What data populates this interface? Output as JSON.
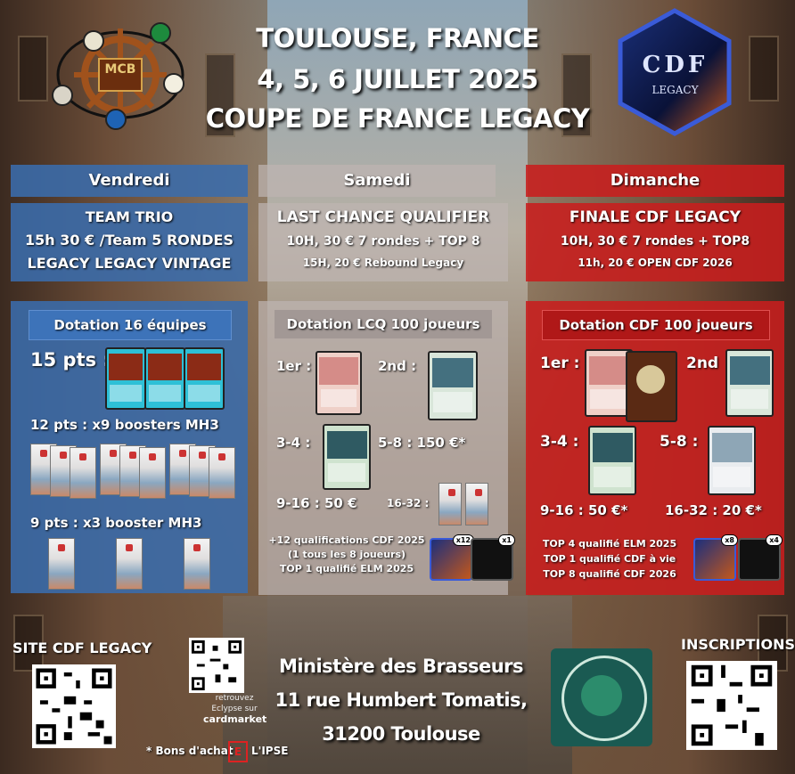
{
  "header": {
    "line1": "TOULOUSE, FRANCE",
    "line2": "4, 5, 6 JUILLET 2025",
    "line3": "COUPE DE FRANCE LEGACY"
  },
  "logos": {
    "mcb": "MCB",
    "cdf_main": "CDF",
    "cdf_sub": "LEGACY"
  },
  "days": {
    "friday": {
      "label": "Vendredi",
      "line1": "TEAM TRIO",
      "line2": "15h 30 € /Team 5 RONDES",
      "line3": "LEGACY LEGACY VINTAGE",
      "dotation": "Dotation 16 équipes",
      "tier1": "15 pts :",
      "tier2": "12 pts : x9 boosters MH3",
      "tier3": "9 pts : x3 booster MH3"
    },
    "saturday": {
      "label": "Samedi",
      "line1": "LAST CHANCE QUALIFIER",
      "line2": "10H, 30 € 7 rondes + TOP 8",
      "line3": "15H, 20 € Rebound Legacy",
      "dotation": "Dotation LCQ 100 joueurs",
      "p1": "1er :",
      "p2": "2nd :",
      "p34": "3-4 :",
      "p58": "5-8 : 150 €*",
      "p916": "9-16 : 50 €",
      "p1632": "16-32 :",
      "info1": "+12 qualifications CDF 2025",
      "info2": "(1 tous les 8 joueurs)",
      "info3": "TOP 1 qualifié ELM 2025",
      "badge1": "x12",
      "badge2": "x1"
    },
    "sunday": {
      "label": "Dimanche",
      "line1": "FINALE CDF LEGACY",
      "line2": "10H, 30 € 7 rondes + TOP8",
      "line3": "11h, 20 € OPEN CDF 2026",
      "dotation": "Dotation CDF 100 joueurs",
      "p1": "1er :",
      "p2": "2nd",
      "p34": "3-4 :",
      "p58": "5-8 :",
      "p916": "9-16 : 50 €*",
      "p1632": "16-32 : 20 €*",
      "info1": "TOP 4 qualifié ELM 2025",
      "info2": "TOP 1 qualifié CDF à vie",
      "info3": "TOP 8 qualifié CDF 2026",
      "badge1": "x8",
      "badge2": "x4"
    }
  },
  "footer": {
    "site": "SITE CDF LEGACY",
    "cardmarket1": "retrouvez",
    "cardmarket2": "Eclypse sur",
    "cardmarket3": "cardmarket",
    "venue1": "Ministère des Brasseurs",
    "venue2": "11 rue Humbert Tomatis,",
    "venue3": "31200 Toulouse",
    "bons": "* Bons d'achat",
    "eclypse": "L'IPSE",
    "inscriptions": "INSCRIPTIONS",
    "brasseurs_logo": "Ministère des Brasseurs"
  },
  "colors": {
    "friday": "#3a6cac",
    "saturday": "#bdb4b2",
    "sunday": "#c81e1e"
  }
}
